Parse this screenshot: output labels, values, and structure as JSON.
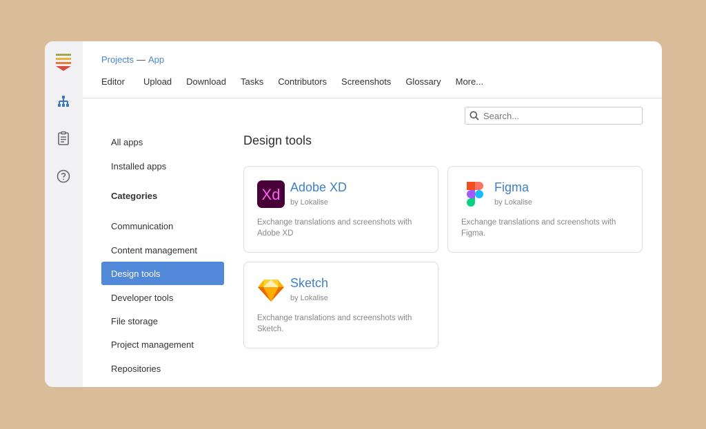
{
  "breadcrumb": {
    "parent": "Projects",
    "separator": "—",
    "current": "App"
  },
  "tabs": [
    {
      "label": "Editor"
    },
    {
      "label": "Upload"
    },
    {
      "label": "Download"
    },
    {
      "label": "Tasks"
    },
    {
      "label": "Contributors"
    },
    {
      "label": "Screenshots"
    },
    {
      "label": "Glossary"
    },
    {
      "label": "More..."
    }
  ],
  "search": {
    "placeholder": "Search..."
  },
  "nav": {
    "all_apps": "All apps",
    "installed_apps": "Installed apps",
    "categories_heading": "Categories",
    "categories": [
      {
        "label": "Communication"
      },
      {
        "label": "Content management"
      },
      {
        "label": "Design tools"
      },
      {
        "label": "Developer tools"
      },
      {
        "label": "File storage"
      },
      {
        "label": "Project management"
      },
      {
        "label": "Repositories"
      }
    ],
    "active": "Design tools"
  },
  "section": {
    "title": "Design tools"
  },
  "apps": [
    {
      "name": "Adobe XD",
      "by": "by Lokalise",
      "description": "Exchange translations and screenshots with Adobe XD",
      "icon": "adobe-xd-logo"
    },
    {
      "name": "Figma",
      "by": "by Lokalise",
      "description": "Exchange translations and screenshots with Figma.",
      "icon": "figma-logo"
    },
    {
      "name": "Sketch",
      "by": "by Lokalise",
      "description": "Exchange translations and screenshots with Sketch.",
      "icon": "sketch-logo"
    }
  ],
  "colors": {
    "accent": "#5288d8",
    "link": "#4a86cc",
    "background": "#d9bc98"
  }
}
